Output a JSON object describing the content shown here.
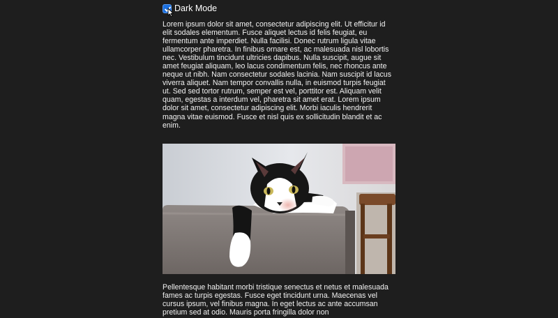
{
  "dark_mode": {
    "label": "Dark Mode",
    "checked": true,
    "accent": "#1a6fe0"
  },
  "content": {
    "paragraph_1": "Lorem ipsum dolor sit amet, consectetur adipiscing elit. Ut efficitur id elit sodales elementum. Fusce aliquet lectus id felis feugiat, eu fermentum ante imperdiet. Nulla facilisi. Donec rutrum ligula vitae ullamcorper pharetra. In finibus ornare est, ac malesuada nisl lobortis nec. Vestibulum tincidunt ultricies dapibus. Nulla suscipit, augue sit amet feugiat aliquam, leo lacus condimentum felis, nec rhoncus ante neque ut nibh. Nam consectetur sodales lacinia. Nam suscipit id lacus viverra aliquet. Nam tempor convallis nulla, in euismod turpis feugiat ut. Sed sed tortor rutrum, semper est vel, porttitor est. Aliquam velit quam, egestas a interdum vel, pharetra sit amet erat. Lorem ipsum dolor sit amet, consectetur adipiscing elit. Morbi iaculis hendrerit magna vitae euismod. Fusce et nisl quis ex sollicitudin blandit et ac enim.",
    "paragraph_2": "Pellentesque habitant morbi tristique senectus et netus et malesuada fames ac turpis egestas. Fusce eget tincidunt urna. Maecenas vel cursus ipsum, vel finibus magna. In eget lectus ac ante accumsan pretium sed at odio. Mauris porta fringilla dolor non"
  },
  "colors": {
    "background": "#1e1e1e",
    "text": "#f2f2f2"
  }
}
